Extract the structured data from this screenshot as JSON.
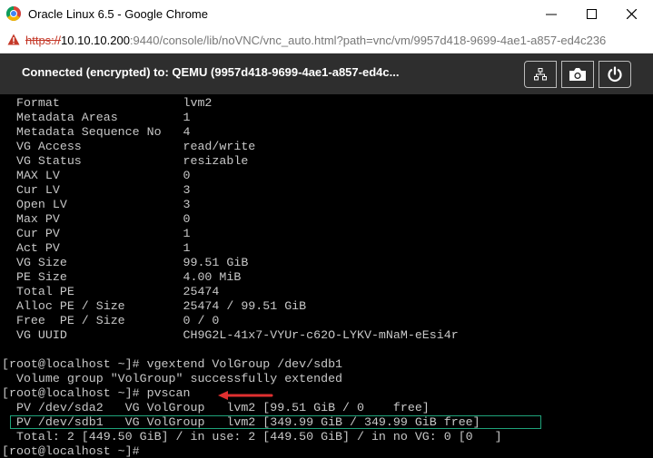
{
  "window": {
    "title": "Oracle Linux 6.5 - Google Chrome",
    "minimize": "—",
    "maximize": "☐",
    "close": "✕"
  },
  "address": {
    "scheme": "https://",
    "host": "10.10.10.200",
    "rest": ":9440/console/lib/noVNC/vnc_auto.html?path=vnc/vm/9957d418-9699-4ae1-a857-ed4c236"
  },
  "vnc": {
    "status": "Connected (encrypted) to: QEMU (9957d418-9699-4ae1-a857-ed4c...",
    "buttons": [
      "network-icon",
      "camera-icon",
      "power-icon"
    ]
  },
  "console": {
    "lines": [
      "  Format                 lvm2",
      "  Metadata Areas         1",
      "  Metadata Sequence No   4",
      "  VG Access              read/write",
      "  VG Status              resizable",
      "  MAX LV                 0",
      "  Cur LV                 3",
      "  Open LV                3",
      "  Max PV                 0",
      "  Cur PV                 1",
      "  Act PV                 1",
      "  VG Size                99.51 GiB",
      "  PE Size                4.00 MiB",
      "  Total PE               25474",
      "  Alloc PE / Size        25474 / 99.51 GiB",
      "  Free  PE / Size        0 / 0",
      "  VG UUID                CH9G2L-41x7-VYUr-c62O-LYKV-mNaM-eEsi4r",
      "",
      "[root@localhost ~]# vgextend VolGroup /dev/sdb1",
      "  Volume group \"VolGroup\" successfully extended",
      "[root@localhost ~]# pvscan",
      "  PV /dev/sda2   VG VolGroup   lvm2 [99.51 GiB / 0    free]",
      "  PV /dev/sdb1   VG VolGroup   lvm2 [349.99 GiB / 349.99 GiB free]",
      "  Total: 2 [449.50 GiB] / in use: 2 [449.50 GiB] / in no VG: 0 [0   ]",
      "[root@localhost ~]#"
    ]
  },
  "colors": {
    "accent_box": "#1fa37a",
    "arrow": "#e03030"
  }
}
